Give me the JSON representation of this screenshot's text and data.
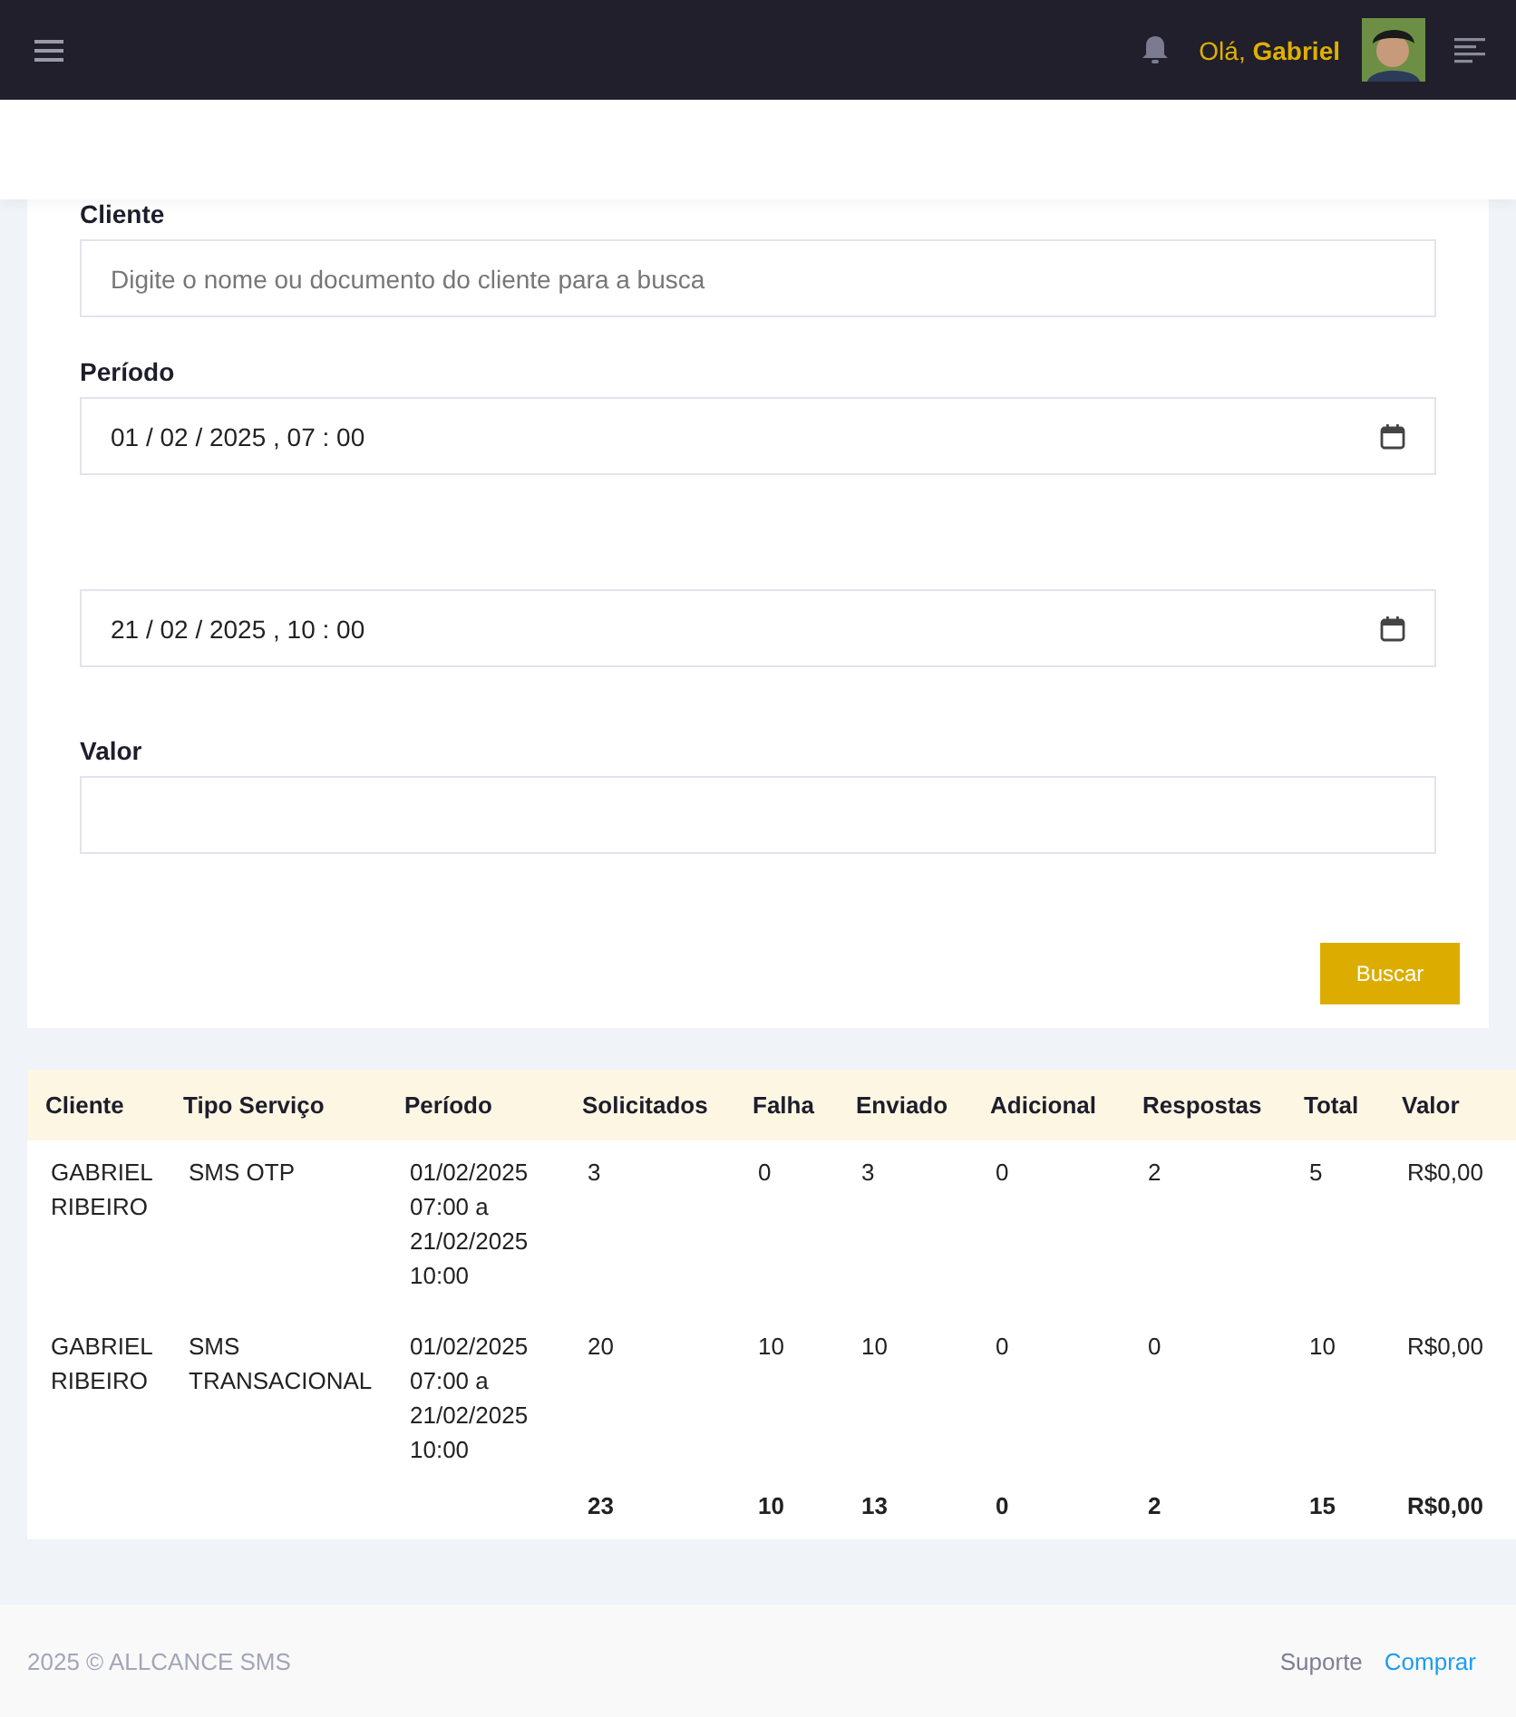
{
  "topbar": {
    "greeting": "Olá,",
    "user": "Gabriel"
  },
  "form": {
    "client": {
      "label": "Cliente",
      "placeholder": "Digite o nome ou documento do cliente para a busca"
    },
    "period": {
      "label": "Período",
      "start": "01 / 02 / 2025 ,  07 : 00",
      "end": "21 / 02 / 2025 ,  10 : 00"
    },
    "value": {
      "label": "Valor"
    },
    "submit": "Buscar"
  },
  "table": {
    "columns": [
      "Cliente",
      "Tipo Serviço",
      "Período",
      "Solicitados",
      "Falha",
      "Enviado",
      "Adicional",
      "Respostas",
      "Total",
      "Valor"
    ],
    "rows": [
      [
        "GABRIEL RIBEIRO",
        "SMS OTP",
        "01/02/2025 07:00 a 21/02/2025 10:00",
        "3",
        "0",
        "3",
        "0",
        "2",
        "5",
        "R$0,00"
      ],
      [
        "GABRIEL RIBEIRO",
        "SMS TRANSACIONAL",
        "01/02/2025 07:00 a 21/02/2025 10:00",
        "20",
        "10",
        "10",
        "0",
        "0",
        "10",
        "R$0,00"
      ]
    ],
    "totals": [
      "23",
      "10",
      "13",
      "0",
      "2",
      "15",
      "R$0,00"
    ]
  },
  "footer": {
    "copyright": "2025 © ALLCANCE SMS",
    "links": [
      "Suporte",
      "Comprar"
    ]
  }
}
